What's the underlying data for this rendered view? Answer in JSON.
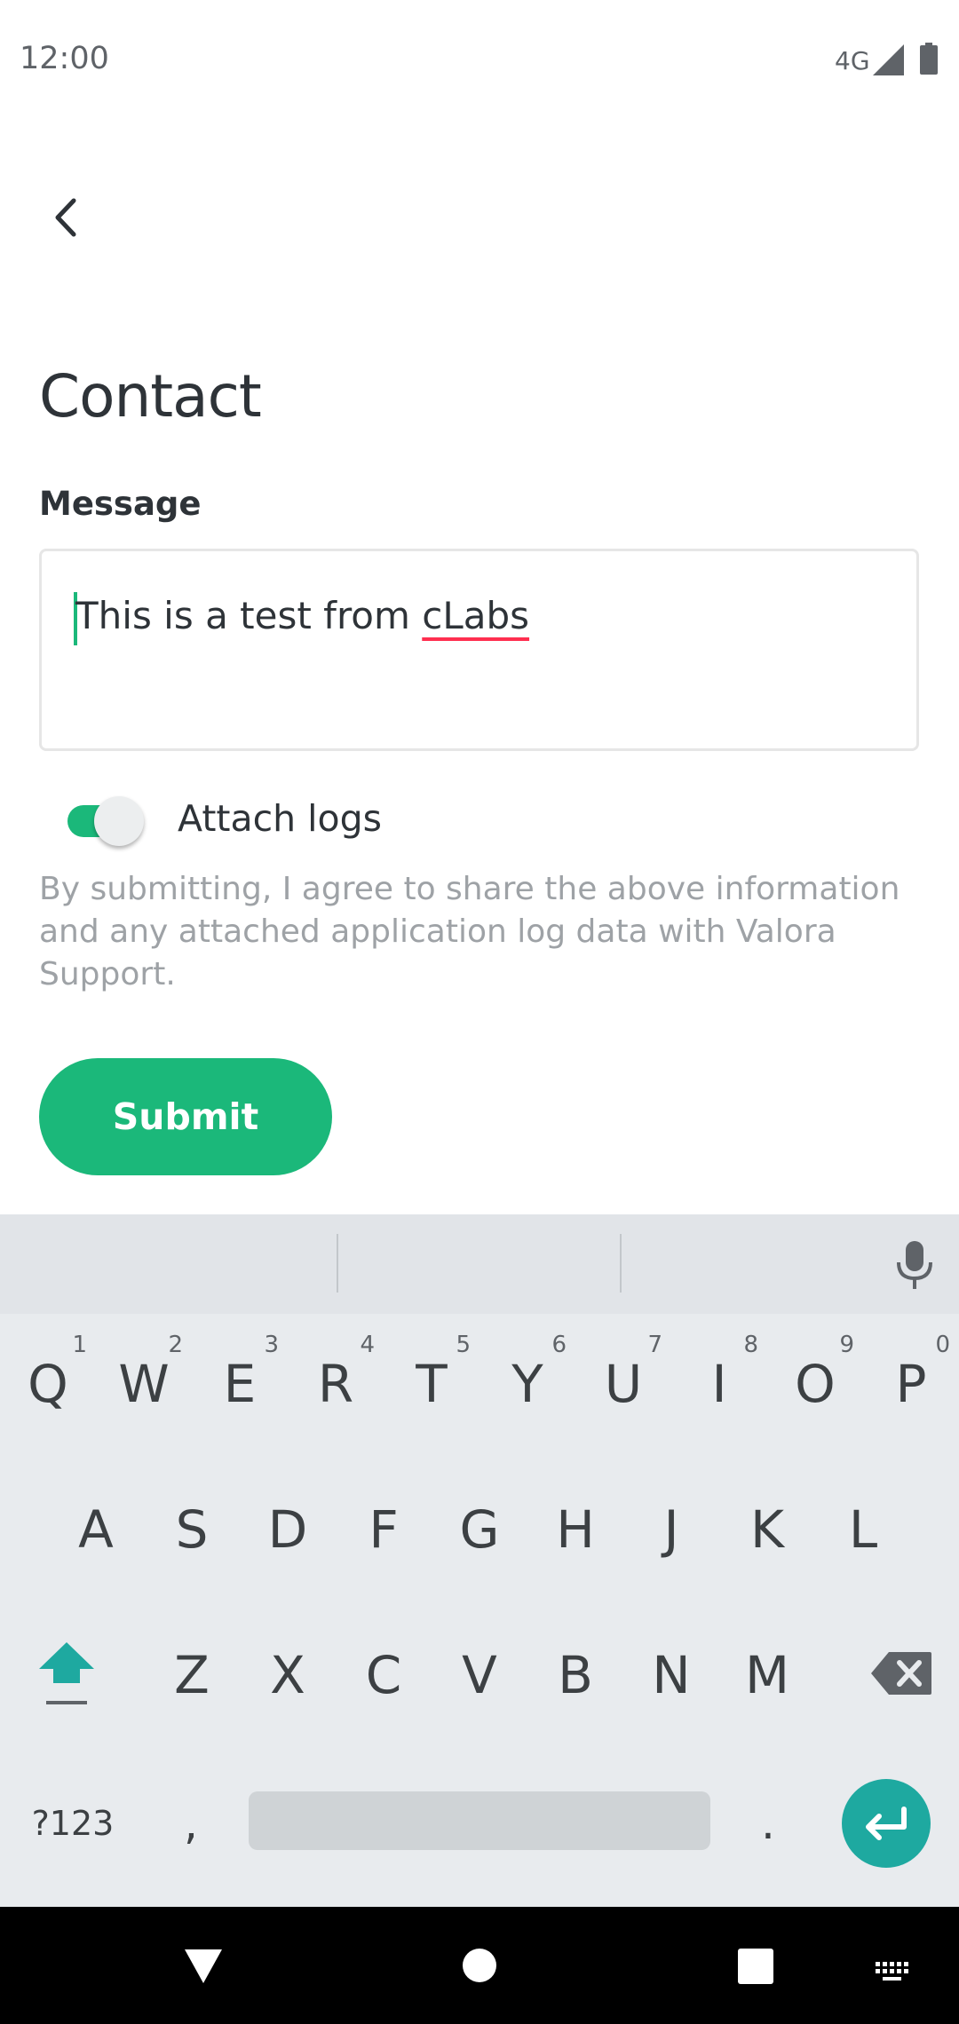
{
  "status_bar": {
    "time": "12:00",
    "network": "4G"
  },
  "header": {
    "back_icon": "chevron-left-icon"
  },
  "page": {
    "title": "Contact",
    "message_label": "Message",
    "message_value_prefix": "This is a test from ",
    "message_value_flagged": "cLabs",
    "attach_logs_label": "Attach logs",
    "attach_logs_on": true,
    "disclaimer_line1": "By submitting, I agree to share the above information",
    "disclaimer_line2": "and any attached application log data with Valora",
    "disclaimer_line3": "Support.",
    "submit_label": "Submit"
  },
  "keyboard": {
    "row1": [
      "Q",
      "W",
      "E",
      "R",
      "T",
      "Y",
      "U",
      "I",
      "O",
      "P"
    ],
    "row1_hints": [
      "1",
      "2",
      "3",
      "4",
      "5",
      "6",
      "7",
      "8",
      "9",
      "0"
    ],
    "row2": [
      "A",
      "S",
      "D",
      "F",
      "G",
      "H",
      "J",
      "K",
      "L"
    ],
    "row3": [
      "Z",
      "X",
      "C",
      "V",
      "B",
      "N",
      "M"
    ],
    "symbols_label": "?123",
    "comma": ",",
    "period": "."
  },
  "colors": {
    "accent": "#1bb87a",
    "spellcheck": "#ff2e4f",
    "keyboard_accent": "#1ea9a0"
  }
}
